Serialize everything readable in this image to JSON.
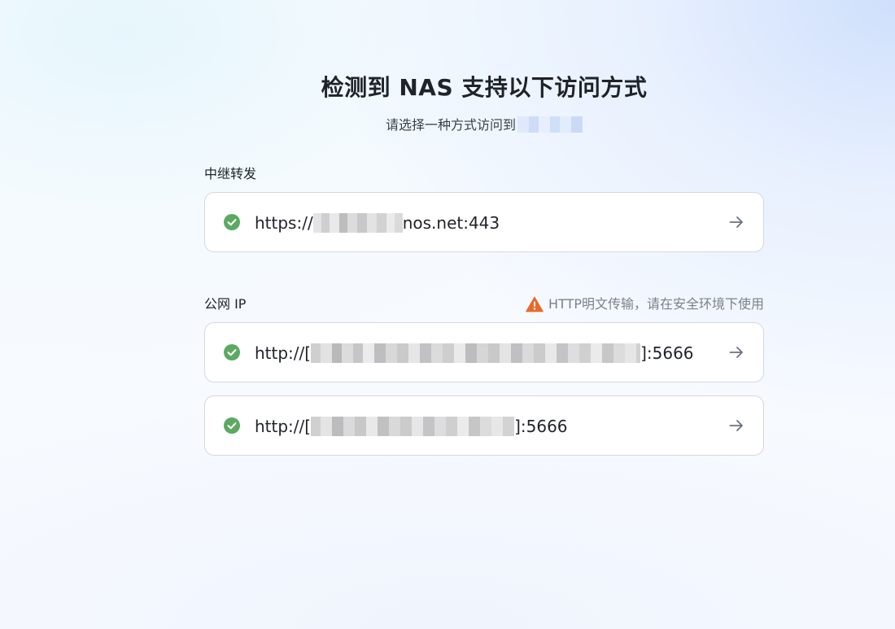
{
  "page": {
    "title": "检测到 NAS 支持以下访问方式",
    "subtitle": "请选择一种方式访问到"
  },
  "relay": {
    "label": "中继转发",
    "option": {
      "url_prefix": "https://",
      "url_suffix": "nos.net:443",
      "status_icon": "check-circle-icon",
      "action_icon": "arrow-right-icon"
    }
  },
  "public_ip": {
    "label": "公网 IP",
    "warning": "HTTP明文传输，请在安全环境下使用",
    "warning_icon": "warning-triangle-icon",
    "options": [
      {
        "url_prefix": "http://[",
        "url_suffix": "]:5666",
        "status_icon": "check-circle-icon",
        "action_icon": "arrow-right-icon"
      },
      {
        "url_prefix": "http://[",
        "url_suffix": "]:5666",
        "status_icon": "check-circle-icon",
        "action_icon": "arrow-right-icon"
      }
    ]
  },
  "colors": {
    "success": "#5aaa62",
    "warning": "#e86a2c",
    "arrow": "#6b7280",
    "card_border": "#d4d9e0"
  }
}
